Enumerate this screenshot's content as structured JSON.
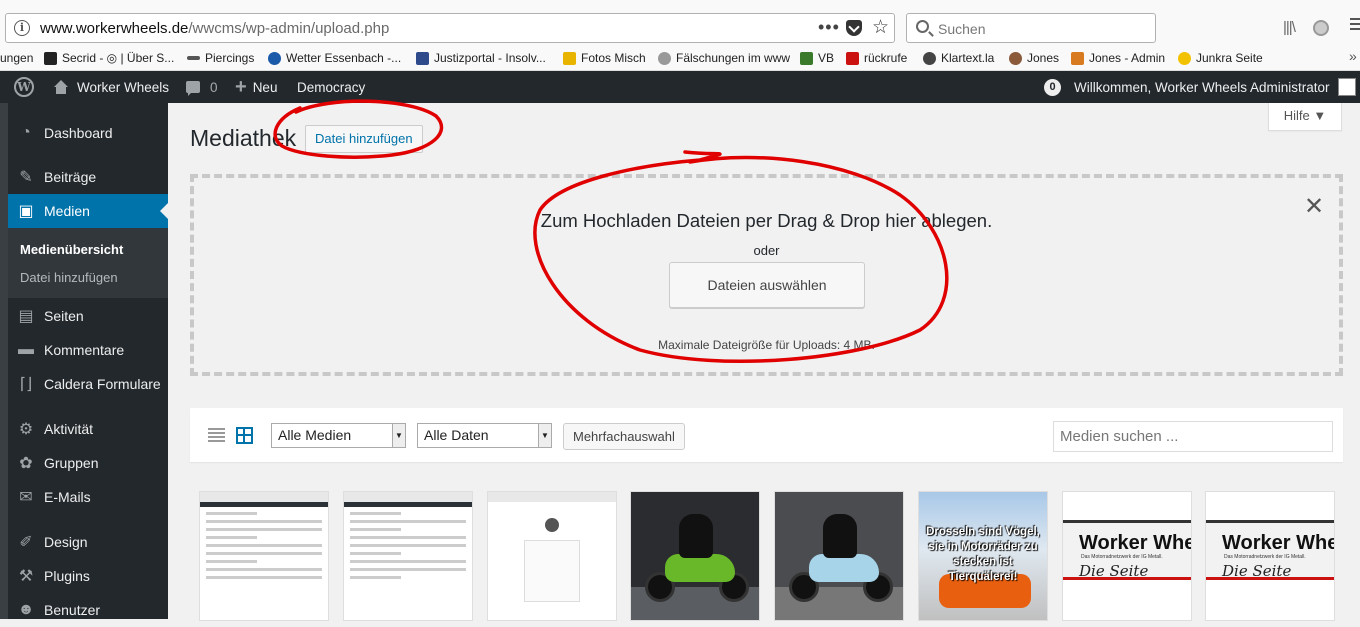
{
  "browser": {
    "url_host": "www.workerwheels.de",
    "url_path": "/wwcms/wp-admin/upload.php",
    "search_placeholder": "Suchen",
    "bookmarks": [
      {
        "label": "ungen",
        "color": "#f9f9fa"
      },
      {
        "label": "Secrid - ◎ | Über S...",
        "color": "#222222"
      },
      {
        "label": "Piercings",
        "color": "#555555"
      },
      {
        "label": "Wetter Essenbach -...",
        "color": "#1a5aa8"
      },
      {
        "label": "Justizportal - Insolv...",
        "color": "#2f4a8a"
      },
      {
        "label": "Fotos Misch",
        "color": "#e8b400"
      },
      {
        "label": "Fälschungen im www",
        "color": "#999999"
      },
      {
        "label": "VB",
        "color": "#3a7a2a"
      },
      {
        "label": "rückrufe",
        "color": "#cc1111"
      },
      {
        "label": "Klartext.la",
        "color": "#444444"
      },
      {
        "label": "Jones",
        "color": "#8a5a3a"
      },
      {
        "label": "Jones - Admin",
        "color": "#d87a20"
      },
      {
        "label": "Junkra Seite",
        "color": "#f2c200"
      }
    ]
  },
  "adminbar": {
    "site_name": "Worker Wheels",
    "comments_count": "0",
    "new_label": "Neu",
    "plugin_item": "Democracy",
    "notification_count": "0",
    "greeting": "Willkommen, Worker Wheels Administrator"
  },
  "sidebar": {
    "items": [
      {
        "label": "Dashboard",
        "icon": "dashboard-icon",
        "glyph": "◔"
      },
      {
        "label": "Beiträge",
        "icon": "pushpin-icon",
        "glyph": "✎"
      },
      {
        "label": "Medien",
        "icon": "media-icon",
        "glyph": "▣"
      },
      {
        "label": "Seiten",
        "icon": "page-icon",
        "glyph": "▤"
      },
      {
        "label": "Kommentare",
        "icon": "comment-icon",
        "glyph": "▬"
      },
      {
        "label": "Caldera Formulare",
        "icon": "form-icon",
        "glyph": "⌈⌋"
      },
      {
        "label": "Aktivität",
        "icon": "activity-icon",
        "glyph": "⚙"
      },
      {
        "label": "Gruppen",
        "icon": "groups-icon",
        "glyph": "✿"
      },
      {
        "label": "E-Mails",
        "icon": "mail-icon",
        "glyph": "✉"
      },
      {
        "label": "Design",
        "icon": "brush-icon",
        "glyph": "✐"
      },
      {
        "label": "Plugins",
        "icon": "plugin-icon",
        "glyph": "⚒"
      },
      {
        "label": "Benutzer",
        "icon": "user-icon",
        "glyph": "☻"
      }
    ],
    "submenu": {
      "current": "Medienübersicht",
      "add": "Datei hinzufügen"
    }
  },
  "main": {
    "title": "Mediathek",
    "add_button": "Datei hinzufügen",
    "help": "Hilfe ▼",
    "upload": {
      "title": "Zum Hochladen Dateien per Drag & Drop hier ablegen.",
      "or": "oder",
      "select_button": "Dateien auswählen",
      "max_size": "Maximale Dateigröße für Uploads: 4 MB."
    },
    "filters": {
      "type_selected": "Alle Medien",
      "date_selected": "Alle Daten",
      "bulk_button": "Mehrfachauswahl",
      "search_placeholder": "Medien suchen ..."
    },
    "thumb_texts": {
      "bird_caption": "Drosseln sind Vögel, sie in Motorräder zu stecken ist Tierquälerei!",
      "ww_title": "Worker Wheels",
      "ww_sub": "Das Motorradnetzwerk der IG Metall.",
      "ww_sig": "Die Seite"
    }
  },
  "colors": {
    "accent": "#0073aa",
    "adminbar": "#23282d",
    "annotation": "#e00000"
  }
}
